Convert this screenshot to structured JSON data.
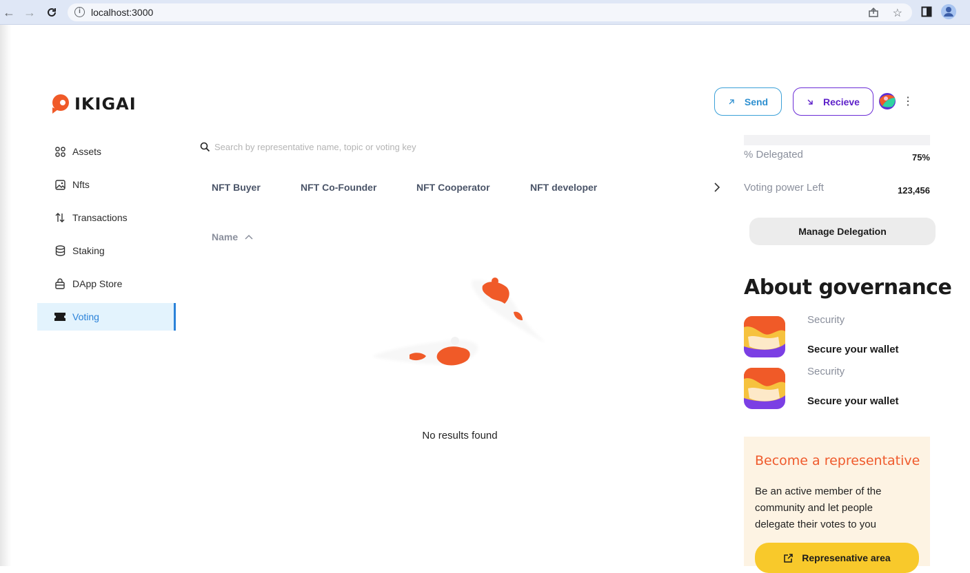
{
  "browser": {
    "url": "localhost:3000"
  },
  "brand": {
    "name": "IKIGAI",
    "accent": "#f05a28"
  },
  "sidebar": {
    "items": [
      {
        "label": "Assets",
        "icon": "grid-icon"
      },
      {
        "label": "Nfts",
        "icon": "image-icon"
      },
      {
        "label": "Transactions",
        "icon": "arrows-updown-icon"
      },
      {
        "label": "Staking",
        "icon": "database-icon"
      },
      {
        "label": "DApp Store",
        "icon": "store-icon"
      },
      {
        "label": "Voting",
        "icon": "ticket-icon",
        "active": true
      }
    ]
  },
  "search": {
    "placeholder": "Search by representative name, topic or voting key"
  },
  "tags": [
    "NFT Buyer",
    "NFT Co-Founder",
    "NFT Cooperator",
    "NFT developer"
  ],
  "table": {
    "sort_column": "Name"
  },
  "empty_state": {
    "text": "No results found"
  },
  "header": {
    "send_label": "Send",
    "receive_label": "Recieve"
  },
  "stats": {
    "delegated_label": "% Delegated",
    "delegated_value": "75%",
    "voting_power_label": "Voting power Left",
    "voting_power_value": "123,456"
  },
  "manage_label": "Manage Delegation",
  "about": {
    "title": "About governance",
    "cards": [
      {
        "category": "Security",
        "title": "Secure your wallet"
      },
      {
        "category": "Security",
        "title": "Secure your wallet"
      }
    ]
  },
  "representative": {
    "title": "Become a representative",
    "text": "Be an active member of the community and let people delegate their votes to you",
    "button_label": "Represenative area"
  }
}
